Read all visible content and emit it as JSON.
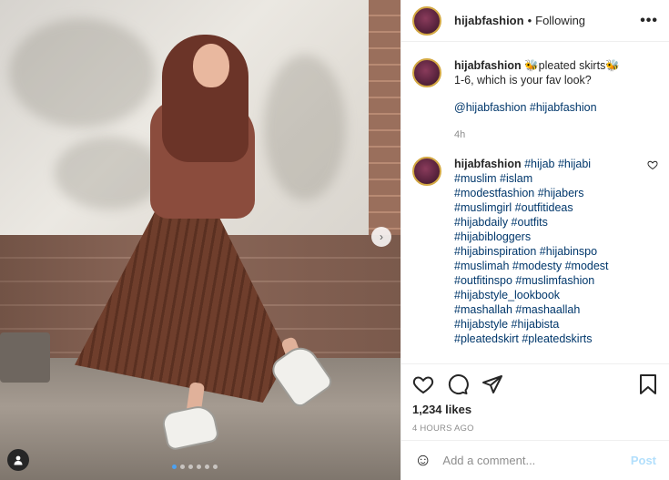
{
  "header": {
    "username": "hijabfashion",
    "separator": "•",
    "follow_status": "Following"
  },
  "caption": {
    "username": "hijabfashion",
    "text_line1": "🐝pleated skirts🐝",
    "text_line2": "1-6, which is your fav look?",
    "mentions": "@hijabfashion #hijabfashion",
    "time": "4h"
  },
  "comment": {
    "username": "hijabfashion",
    "first_line": "#hijab #hijabi",
    "lines": [
      "#muslim #islam",
      "#modestfashion #hijabers",
      "#muslimgirl #outfitideas",
      "#hijabdaily #outfits",
      "#hijabibloggers",
      "#hijabinspiration #hijabinspo",
      "#muslimah #modesty #modest",
      "#outfitinspo #muslimfashion",
      "#hijabstyle_lookbook",
      "#mashallah #mashaallah",
      "#hijabstyle #hijabista",
      "#pleatedskirt #pleatedskirts"
    ]
  },
  "actions": {
    "likes": "1,234 likes",
    "timestamp": "4 HOURS AGO"
  },
  "add_comment": {
    "placeholder": "Add a comment...",
    "post_label": "Post"
  },
  "colors": {
    "link": "#00376b",
    "muted": "#8e8e8e",
    "post_disabled": "#b2dffc",
    "carousel_active_dot": "#4da1f0"
  },
  "icons": [
    "more-icon",
    "heart-icon",
    "comment-icon",
    "share-icon",
    "save-icon",
    "emoji-icon",
    "carousel-next-icon",
    "user-tag-icon"
  ]
}
